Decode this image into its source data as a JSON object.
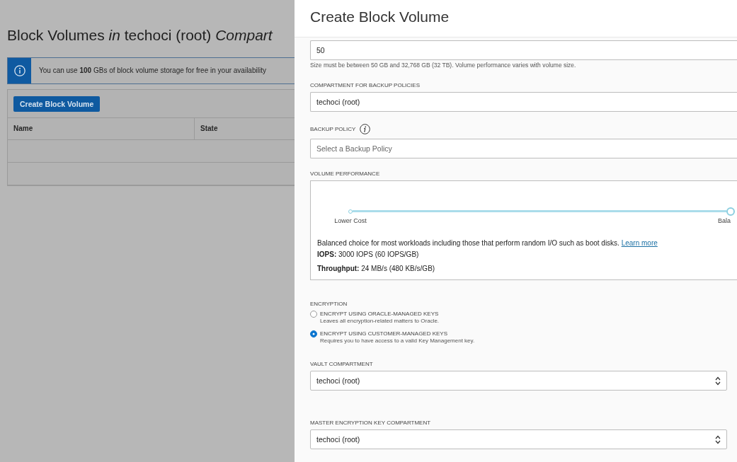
{
  "background_page": {
    "title": "Block Volumes *in* techoci (root) *Compart*",
    "notice": "You can use **100** GBs of block volume storage for free in your availability",
    "create_button": "Create Block Volume",
    "table": {
      "columns": [
        "Name",
        "State"
      ]
    }
  },
  "panel": {
    "title": "Create Block Volume",
    "size": {
      "value": "50",
      "hint": "Size must be between 50 GB and 32,768 GB (32 TB). Volume performance varies with volume size."
    },
    "backup_compartment": {
      "label": "COMPARTMENT FOR BACKUP POLICIES",
      "value": "techoci (root)"
    },
    "backup_policy": {
      "label": "BACKUP POLICY",
      "placeholder": "Select a Backup Policy"
    },
    "volume_performance": {
      "label": "VOLUME PERFORMANCE",
      "stops": [
        {
          "label": "Lower Cost",
          "selected": false
        },
        {
          "label": "Bala",
          "selected": true
        }
      ],
      "description": "Balanced choice for most workloads including those that perform random I/O such as boot disks.",
      "link": "Learn more",
      "iops": "**IOPS:** 3000 IOPS (60 IOPS/GB)",
      "throughput": "**Throughput:** 24 MB/s (480 KB/s/GB)"
    },
    "encryption": {
      "label": "ENCRYPTION",
      "options": [
        {
          "title": "ENCRYPT USING ORACLE-MANAGED KEYS",
          "description": "Leaves all encryption-related matters to Oracle.",
          "selected": false
        },
        {
          "title": "ENCRYPT USING CUSTOMER-MANAGED KEYS",
          "description": "Requires you to have access to a valid Key Management key.",
          "selected": true
        }
      ]
    },
    "vault_compartment": {
      "label": "VAULT COMPARTMENT",
      "value": "techoci (root)"
    },
    "key_compartment": {
      "label": "MASTER ENCRYPTION KEY COMPARTMENT",
      "value": "techoci (root)"
    }
  }
}
